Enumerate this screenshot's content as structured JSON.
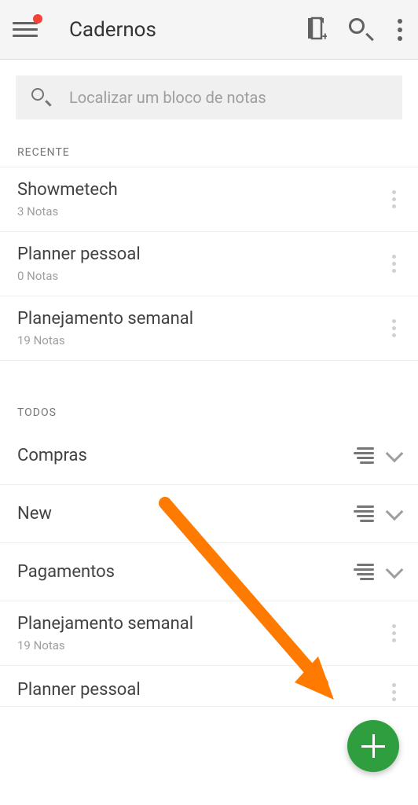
{
  "header": {
    "title": "Cadernos"
  },
  "search": {
    "placeholder": "Localizar um bloco de notas"
  },
  "sections": {
    "recent_label": "RECENTE",
    "all_label": "TODOS"
  },
  "recent": [
    {
      "name": "Showmetech",
      "count": "3 Notas"
    },
    {
      "name": "Planner pessoal",
      "count": "0 Notas"
    },
    {
      "name": "Planejamento semanal",
      "count": "19 Notas"
    }
  ],
  "all": [
    {
      "name": "Compras"
    },
    {
      "name": "New"
    },
    {
      "name": "Pagamentos"
    }
  ],
  "all_detail": [
    {
      "name": "Planejamento semanal",
      "count": "19 Notas"
    },
    {
      "name": "Planner pessoal",
      "count": ""
    }
  ]
}
